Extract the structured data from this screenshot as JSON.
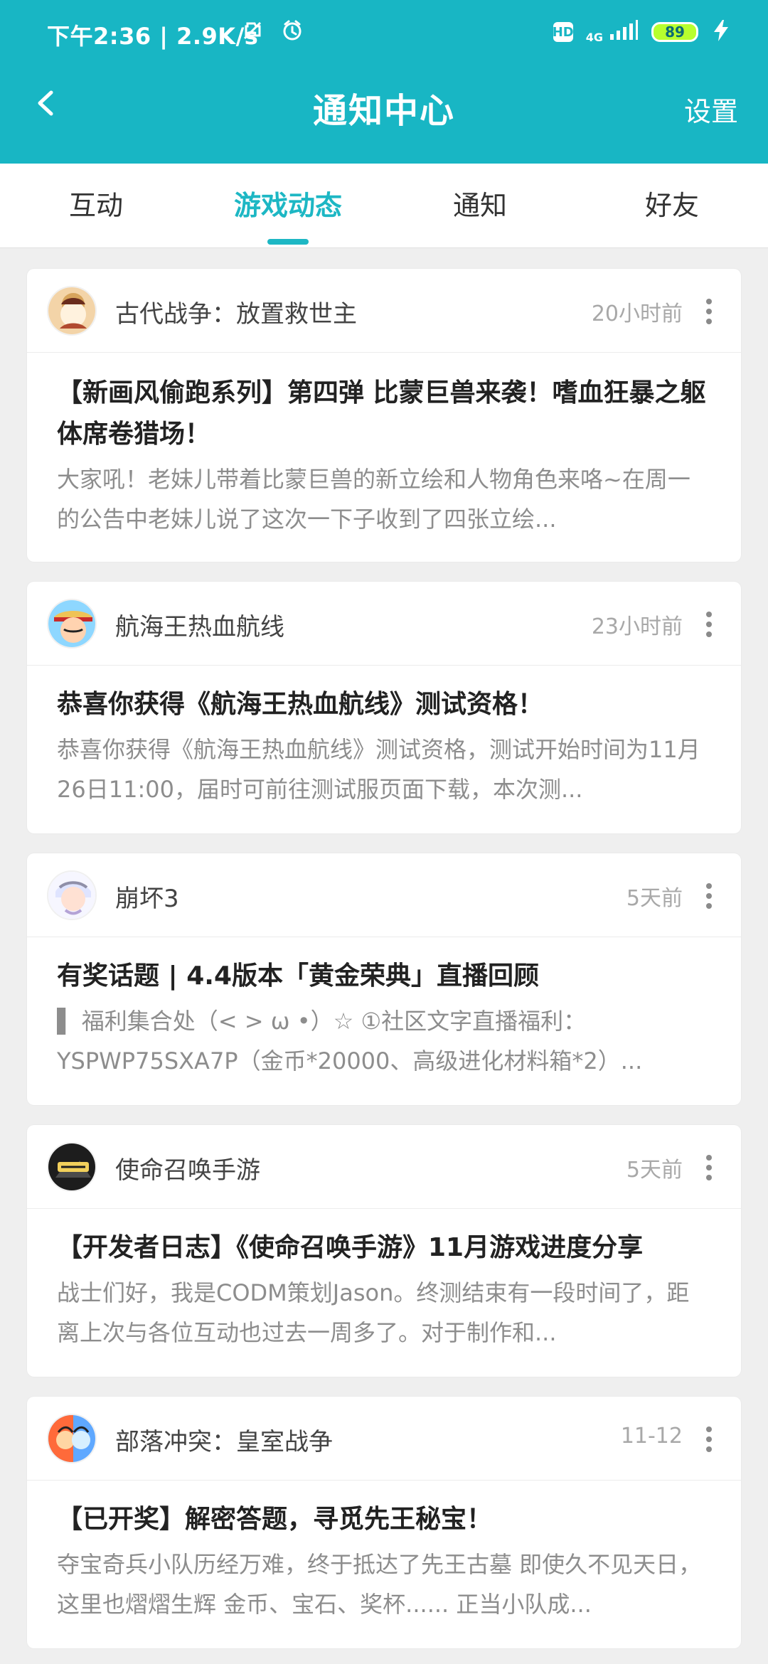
{
  "status_bar": {
    "time": "下午2:36",
    "speed": "2.9K/s",
    "network": "4G",
    "battery": "89"
  },
  "nav": {
    "title": "通知中心",
    "settings": "设置"
  },
  "tabs": [
    {
      "label": "互动"
    },
    {
      "label": "游戏动态"
    },
    {
      "label": "通知"
    },
    {
      "label": "好友"
    }
  ],
  "cards": [
    {
      "game": "古代战争：放置救世主",
      "time": "20小时前",
      "title": "【新画风偷跑系列】第四弹 比蒙巨兽来袭！嗜血狂暴之躯体席卷猎场！",
      "summary": "大家吼！老妹儿带着比蒙巨兽的新立绘和人物角色来咯~在周一的公告中老妹儿说了这次一下子收到了四张立绘..."
    },
    {
      "game": "航海王热血航线",
      "time": "23小时前",
      "title": "恭喜你获得《航海王热血航线》测试资格！",
      "summary": "恭喜你获得《航海王热血航线》测试资格，测试开始时间为11月26日11:00，届时可前往测试服页面下载，本次测..."
    },
    {
      "game": "崩坏3",
      "time": "5天前",
      "title": "有奖话题 | 4.4版本「黄金荣典」直播回顾",
      "summary": "▌ 福利集合处（< > ω •）☆ ①社区文字直播福利：YSPWP75SXA7P（金币*20000、高级进化材料箱*2）..."
    },
    {
      "game": "使命召唤手游",
      "time": "5天前",
      "title": "【开发者日志】《使命召唤手游》11月游戏进度分享",
      "summary": "战士们好，我是CODM策划Jason。终测结束有一段时间了，距离上次与各位互动也过去一周多了。对于制作和..."
    },
    {
      "game": "部落冲突：皇室战争",
      "time": "11-12",
      "title": "【已开奖】解密答题，寻觅先王秘宝！",
      "summary": "夺宝奇兵小队历经万难，终于抵达了先王古墓 即使久不见天日，这里也熠熠生辉 金币、宝石、奖杯...... 正当小队成..."
    }
  ]
}
